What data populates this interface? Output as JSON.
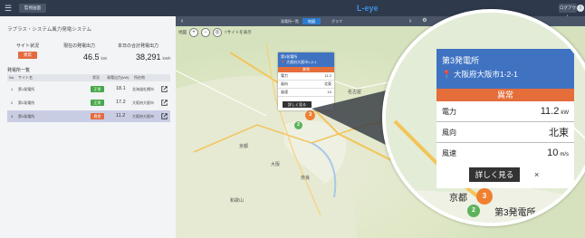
{
  "topbar": {
    "menu_icon": "menu-icon",
    "nav_button_label": "監視画面",
    "logo": "L-eye",
    "logout_label": "ログアウト",
    "info_icon": "info-icon"
  },
  "left": {
    "system_title": "ラプラス・システム風力発電システム",
    "site_status_label": "サイト状況",
    "site_status_value": "異常",
    "current_output_label": "現在の発電出力",
    "current_output_value": "46.5",
    "current_output_unit": "kW",
    "today_total_label": "本日の合計発電出力",
    "today_total_value": "38,291",
    "today_total_unit": "kWh",
    "list_title": "発電所一覧",
    "columns": [
      "No.",
      "サイト名",
      "状況",
      "発電出力(kW)",
      "所在地"
    ],
    "rows": [
      {
        "no": "1",
        "name": "第1発電所",
        "status": "正常",
        "status_color": "#46a84a",
        "output": "18.1",
        "location": "北海道札幌市",
        "selected": false
      },
      {
        "no": "2",
        "name": "第2発電所",
        "status": "正常",
        "status_color": "#46a84a",
        "output": "17.2",
        "location": "大阪府大阪市",
        "selected": false
      },
      {
        "no": "3",
        "name": "第3発電所",
        "status": "異常",
        "status_color": "#e36b3f",
        "output": "11.2",
        "location": "大阪府大阪市",
        "selected": true
      }
    ]
  },
  "map": {
    "tabs": [
      {
        "label": "発電所一覧",
        "active": false
      },
      {
        "label": "地図",
        "active": true
      },
      {
        "label": "グラフ",
        "active": false
      }
    ],
    "toolbar_label": "地図",
    "toolbar_text": "□サイトを表示",
    "popup_small": {
      "title": "第3発電所",
      "address": "大阪府大阪市1-2-1",
      "status": "異常",
      "rows": [
        {
          "label": "電力",
          "value": "11.2",
          "unit": "kW"
        },
        {
          "label": "風向",
          "value": "北東",
          "unit": ""
        },
        {
          "label": "風速",
          "value": "10",
          "unit": "m/s"
        }
      ],
      "button": "詳しく見る"
    },
    "labels": [
      "京都",
      "大阪",
      "奈良",
      "和歌山",
      "名古屋",
      "岐阜"
    ],
    "pins": [
      {
        "count": "2",
        "color": "#5db35c"
      },
      {
        "count": "3",
        "color": "#f08030"
      }
    ]
  },
  "zoom": {
    "title": "第3発電所",
    "address": "大阪府大阪市1-2-1",
    "status": "異常",
    "rows": [
      {
        "label": "電力",
        "value": "11.2",
        "unit": "kW"
      },
      {
        "label": "風向",
        "value": "北東",
        "unit": ""
      },
      {
        "label": "風速",
        "value": "10",
        "unit": "m/s"
      }
    ],
    "button": "詳しく見る",
    "close": "×",
    "place_label_1": "京都",
    "place_label_2": "第3発電所",
    "pin_3": "3",
    "pin_2": "2"
  }
}
